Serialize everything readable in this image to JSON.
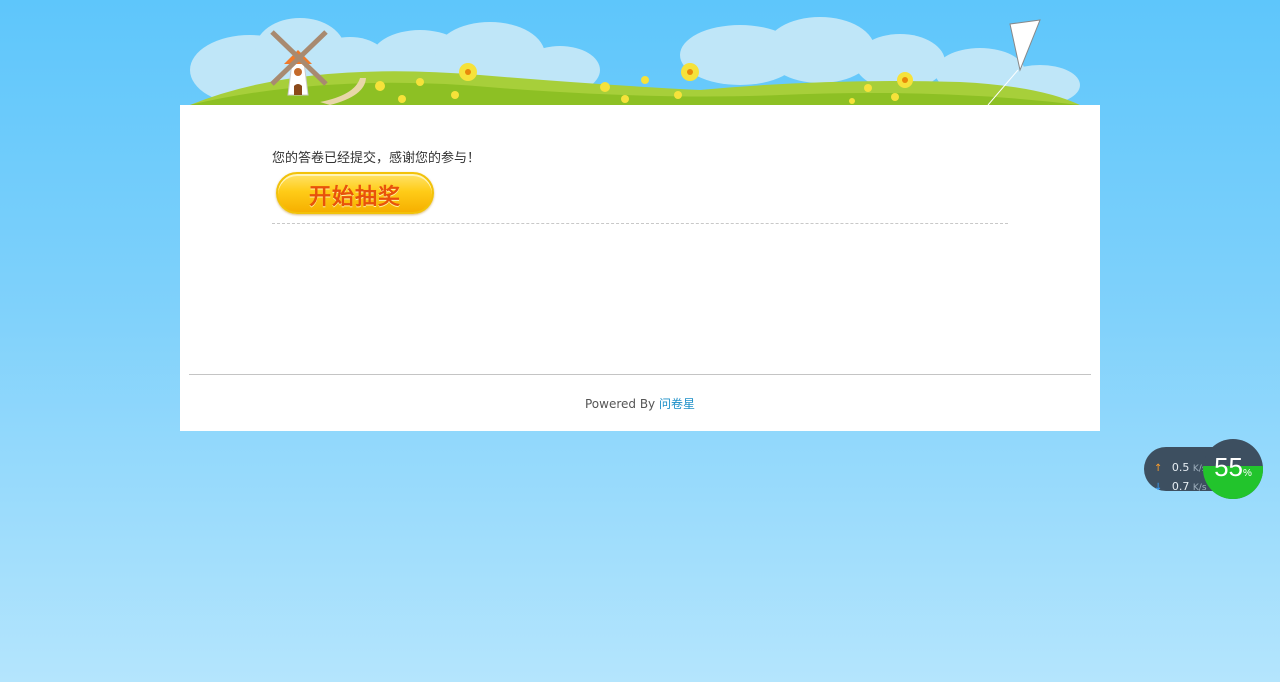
{
  "message": {
    "thanks_text": "您的答卷已经提交，感谢您的参与！"
  },
  "lottery_button": {
    "label": "开始抽奖"
  },
  "footer": {
    "powered_by": "Powered By",
    "brand": "问卷星"
  },
  "network_widget": {
    "upload_speed": "0.5",
    "download_speed": "0.7",
    "speed_unit": "K/s",
    "percent": "55",
    "percent_value": 0.55,
    "percent_sign": "%"
  },
  "colors": {
    "sky_top": "#5ec6fb",
    "sky_bottom": "#b4e5fd",
    "button_text": "#e8520a",
    "link": "#1e90c8",
    "widget_green": "#22c42c"
  },
  "icons": {
    "upload": "arrow-up-icon",
    "download": "arrow-down-icon"
  }
}
